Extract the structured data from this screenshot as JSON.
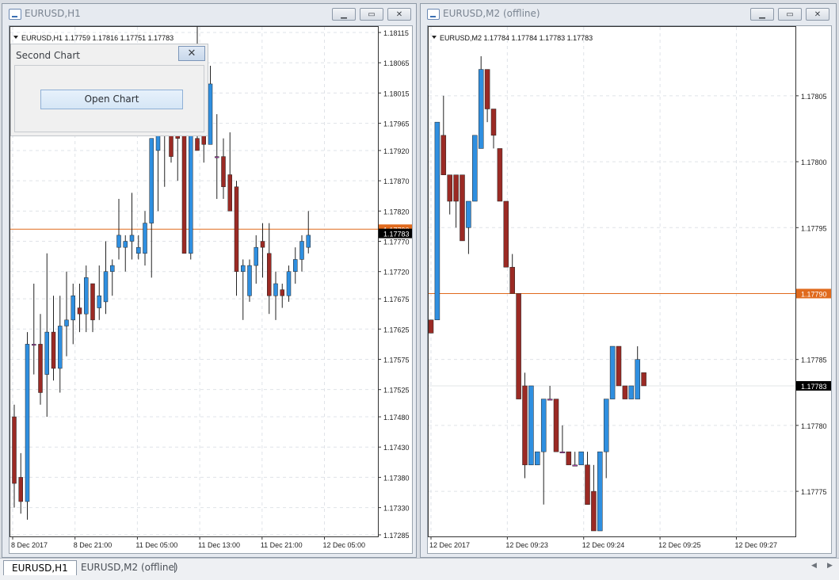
{
  "windows": [
    {
      "title": "EURUSD,H1",
      "info": "EURUSD,H1  1.17759 1.17816 1.17751 1.17783",
      "current_price_label": "1.17783",
      "line_price_label": "1.17790",
      "price_ticks": [
        "1.18115",
        "1.18065",
        "1.18015",
        "1.17965",
        "1.17920",
        "1.17870",
        "1.17820",
        "1.17770",
        "1.17720",
        "1.17675",
        "1.17625",
        "1.17575",
        "1.17525",
        "1.17480",
        "1.17430",
        "1.17380",
        "1.17330",
        "1.17285"
      ],
      "time_ticks": [
        "8 Dec 2017",
        "8 Dec 21:00",
        "11 Dec 05:00",
        "11 Dec 13:00",
        "11 Dec 21:00",
        "12 Dec 05:00"
      ]
    },
    {
      "title": "EURUSD,M2 (offline)",
      "info": "EURUSD,M2  1.17784 1.17784 1.17783 1.17783",
      "current_price_label": "1.17783",
      "line_price_label": "1.17790",
      "price_ticks": [
        "1.17805",
        "1.17800",
        "1.17795",
        "1.17790",
        "1.17785",
        "1.17780",
        "1.17775"
      ],
      "time_ticks": [
        "12 Dec 2017",
        "12 Dec 09:23",
        "12 Dec 09:24",
        "12 Dec 09:25",
        "12 Dec 09:27"
      ]
    }
  ],
  "dialog": {
    "title": "Second Chart",
    "button_label": "Open Chart"
  },
  "tabs": [
    {
      "label": "EURUSD,H1"
    },
    {
      "label": "EURUSD,M2 (offline)"
    }
  ],
  "colors": {
    "bull": "#2f8fe0",
    "bear": "#9b2a24",
    "doji": "#b040b0",
    "line": "#e06a1d",
    "current_label_bg": "#000000",
    "line_label_bg": "#e06a1d"
  },
  "icons": {
    "window": "chart-window-icon",
    "minimize": "minimize-icon",
    "restore": "restore-icon",
    "close": "close-icon",
    "info": "triangle-down-icon"
  },
  "chart_data": [
    {
      "type": "candlestick",
      "symbol": "EURUSD",
      "timeframe": "H1",
      "ylim": [
        1.17285,
        1.18115
      ],
      "horizontal_line": 1.1779,
      "current_price": 1.17783,
      "candles": [
        {
          "o": 1.1748,
          "h": 1.175,
          "l": 1.1733,
          "c": 1.1737
        },
        {
          "o": 1.1738,
          "h": 1.1742,
          "l": 1.1732,
          "c": 1.1734
        },
        {
          "o": 1.1734,
          "h": 1.1762,
          "l": 1.1731,
          "c": 1.176
        },
        {
          "o": 1.176,
          "h": 1.177,
          "l": 1.1755,
          "c": 1.176
        },
        {
          "o": 1.176,
          "h": 1.1765,
          "l": 1.175,
          "c": 1.1752
        },
        {
          "o": 1.1755,
          "h": 1.1775,
          "l": 1.1748,
          "c": 1.1762
        },
        {
          "o": 1.1762,
          "h": 1.1768,
          "l": 1.1754,
          "c": 1.1756
        },
        {
          "o": 1.1756,
          "h": 1.1768,
          "l": 1.1752,
          "c": 1.1763
        },
        {
          "o": 1.1763,
          "h": 1.1772,
          "l": 1.1758,
          "c": 1.1764
        },
        {
          "o": 1.1764,
          "h": 1.177,
          "l": 1.176,
          "c": 1.1768
        },
        {
          "o": 1.1766,
          "h": 1.177,
          "l": 1.1762,
          "c": 1.1765
        },
        {
          "o": 1.1765,
          "h": 1.1773,
          "l": 1.1762,
          "c": 1.1771
        },
        {
          "o": 1.177,
          "h": 1.177,
          "l": 1.1762,
          "c": 1.1764
        },
        {
          "o": 1.1766,
          "h": 1.1773,
          "l": 1.1764,
          "c": 1.1768
        },
        {
          "o": 1.1767,
          "h": 1.1777,
          "l": 1.1765,
          "c": 1.1772
        },
        {
          "o": 1.1772,
          "h": 1.1774,
          "l": 1.1768,
          "c": 1.1773
        },
        {
          "o": 1.1776,
          "h": 1.1784,
          "l": 1.1774,
          "c": 1.1778
        },
        {
          "o": 1.1776,
          "h": 1.1778,
          "l": 1.1772,
          "c": 1.1777
        },
        {
          "o": 1.1777,
          "h": 1.1785,
          "l": 1.1774,
          "c": 1.1778
        },
        {
          "o": 1.1775,
          "h": 1.1778,
          "l": 1.1774,
          "c": 1.1776
        },
        {
          "o": 1.1775,
          "h": 1.1782,
          "l": 1.1773,
          "c": 1.178
        },
        {
          "o": 1.178,
          "h": 1.1792,
          "l": 1.1771,
          "c": 1.1794
        },
        {
          "o": 1.1792,
          "h": 1.1802,
          "l": 1.1782,
          "c": 1.1797
        },
        {
          "o": 1.1796,
          "h": 1.1799,
          "l": 1.1786,
          "c": 1.1798
        },
        {
          "o": 1.1798,
          "h": 1.1796,
          "l": 1.179,
          "c": 1.1791
        },
        {
          "o": 1.1796,
          "h": 1.18,
          "l": 1.1787,
          "c": 1.1794
        },
        {
          "o": 1.1795,
          "h": 1.1804,
          "l": 1.1776,
          "c": 1.1775
        },
        {
          "o": 1.1775,
          "h": 1.1796,
          "l": 1.1774,
          "c": 1.1795
        },
        {
          "o": 1.1794,
          "h": 1.1813,
          "l": 1.1792,
          "c": 1.1792
        },
        {
          "o": 1.1796,
          "h": 1.1798,
          "l": 1.179,
          "c": 1.1793
        },
        {
          "o": 1.1793,
          "h": 1.1806,
          "l": 1.1793,
          "c": 1.1803
        },
        {
          "o": 1.1791,
          "h": 1.1798,
          "l": 1.1784,
          "c": 1.1791
        },
        {
          "o": 1.1791,
          "h": 1.1794,
          "l": 1.1784,
          "c": 1.1786
        },
        {
          "o": 1.1788,
          "h": 1.1795,
          "l": 1.1782,
          "c": 1.1782
        },
        {
          "o": 1.1786,
          "h": 1.1787,
          "l": 1.1768,
          "c": 1.1772
        },
        {
          "o": 1.1772,
          "h": 1.1774,
          "l": 1.1764,
          "c": 1.1773
        },
        {
          "o": 1.1768,
          "h": 1.1774,
          "l": 1.1767,
          "c": 1.1773
        },
        {
          "o": 1.1773,
          "h": 1.1778,
          "l": 1.177,
          "c": 1.1776
        },
        {
          "o": 1.1777,
          "h": 1.178,
          "l": 1.1771,
          "c": 1.1776
        },
        {
          "o": 1.1775,
          "h": 1.178,
          "l": 1.1765,
          "c": 1.1768
        },
        {
          "o": 1.1768,
          "h": 1.1772,
          "l": 1.1764,
          "c": 1.177
        },
        {
          "o": 1.1769,
          "h": 1.177,
          "l": 1.1766,
          "c": 1.1768
        },
        {
          "o": 1.1768,
          "h": 1.1773,
          "l": 1.1767,
          "c": 1.1772
        },
        {
          "o": 1.1772,
          "h": 1.1776,
          "l": 1.177,
          "c": 1.1774
        },
        {
          "o": 1.1774,
          "h": 1.1778,
          "l": 1.1772,
          "c": 1.1777
        },
        {
          "o": 1.1776,
          "h": 1.1782,
          "l": 1.1775,
          "c": 1.1778
        }
      ]
    },
    {
      "type": "candlestick",
      "symbol": "EURUSD",
      "timeframe": "M2",
      "ylim": [
        1.177717,
        1.178098
      ],
      "horizontal_line": 1.1779,
      "current_price": 1.17783,
      "candles": [
        {
          "o": 1.17788,
          "h": 1.17788,
          "l": 1.17787,
          "c": 1.17787
        },
        {
          "o": 1.17788,
          "h": 1.17803,
          "l": 1.17788,
          "c": 1.17803
        },
        {
          "o": 1.17802,
          "h": 1.17805,
          "l": 1.17799,
          "c": 1.17799
        },
        {
          "o": 1.17799,
          "h": 1.17799,
          "l": 1.17796,
          "c": 1.17797
        },
        {
          "o": 1.17799,
          "h": 1.17799,
          "l": 1.17795,
          "c": 1.17797
        },
        {
          "o": 1.17799,
          "h": 1.17799,
          "l": 1.17795,
          "c": 1.17794
        },
        {
          "o": 1.17795,
          "h": 1.17797,
          "l": 1.17793,
          "c": 1.17797
        },
        {
          "o": 1.17797,
          "h": 1.17802,
          "l": 1.17797,
          "c": 1.17802
        },
        {
          "o": 1.17801,
          "h": 1.17808,
          "l": 1.17801,
          "c": 1.17807
        },
        {
          "o": 1.17807,
          "h": 1.17806,
          "l": 1.17803,
          "c": 1.17804
        },
        {
          "o": 1.17804,
          "h": 1.17803,
          "l": 1.17801,
          "c": 1.17802
        },
        {
          "o": 1.17801,
          "h": 1.17799,
          "l": 1.17797,
          "c": 1.17797
        },
        {
          "o": 1.17797,
          "h": 1.17797,
          "l": 1.17792,
          "c": 1.17792
        },
        {
          "o": 1.17792,
          "h": 1.17793,
          "l": 1.1779,
          "c": 1.1779
        },
        {
          "o": 1.1779,
          "h": 1.1779,
          "l": 1.17782,
          "c": 1.17782
        },
        {
          "o": 1.17783,
          "h": 1.17784,
          "l": 1.17776,
          "c": 1.17777
        },
        {
          "o": 1.17777,
          "h": 1.17783,
          "l": 1.17777,
          "c": 1.17783
        },
        {
          "o": 1.17777,
          "h": 1.17777,
          "l": 1.17777,
          "c": 1.17778
        },
        {
          "o": 1.17778,
          "h": 1.17782,
          "l": 1.17774,
          "c": 1.17782
        },
        {
          "o": 1.17782,
          "h": 1.17783,
          "l": 1.17782,
          "c": 1.17782
        },
        {
          "o": 1.17782,
          "h": 1.17782,
          "l": 1.17778,
          "c": 1.17778
        },
        {
          "o": 1.17778,
          "h": 1.1778,
          "l": 1.17778,
          "c": 1.17778
        },
        {
          "o": 1.17778,
          "h": 1.17778,
          "l": 1.17777,
          "c": 1.17777
        },
        {
          "o": 1.17777,
          "h": 1.17778,
          "l": 1.17777,
          "c": 1.17777
        },
        {
          "o": 1.17777,
          "h": 1.17778,
          "l": 1.17777,
          "c": 1.17778
        },
        {
          "o": 1.17777,
          "h": 1.17778,
          "l": 1.17774,
          "c": 1.17774
        },
        {
          "o": 1.17775,
          "h": 1.17777,
          "l": 1.17772,
          "c": 1.17772
        },
        {
          "o": 1.17772,
          "h": 1.17778,
          "l": 1.17772,
          "c": 1.17778
        },
        {
          "o": 1.17778,
          "h": 1.17782,
          "l": 1.17776,
          "c": 1.17782
        },
        {
          "o": 1.17782,
          "h": 1.17786,
          "l": 1.17782,
          "c": 1.17786
        },
        {
          "o": 1.17786,
          "h": 1.17786,
          "l": 1.17783,
          "c": 1.17783
        },
        {
          "o": 1.17783,
          "h": 1.17783,
          "l": 1.17782,
          "c": 1.17782
        },
        {
          "o": 1.17782,
          "h": 1.17783,
          "l": 1.17782,
          "c": 1.17783
        },
        {
          "o": 1.17782,
          "h": 1.17786,
          "l": 1.17782,
          "c": 1.17785
        },
        {
          "o": 1.17784,
          "h": 1.17784,
          "l": 1.17783,
          "c": 1.17783
        }
      ]
    }
  ]
}
